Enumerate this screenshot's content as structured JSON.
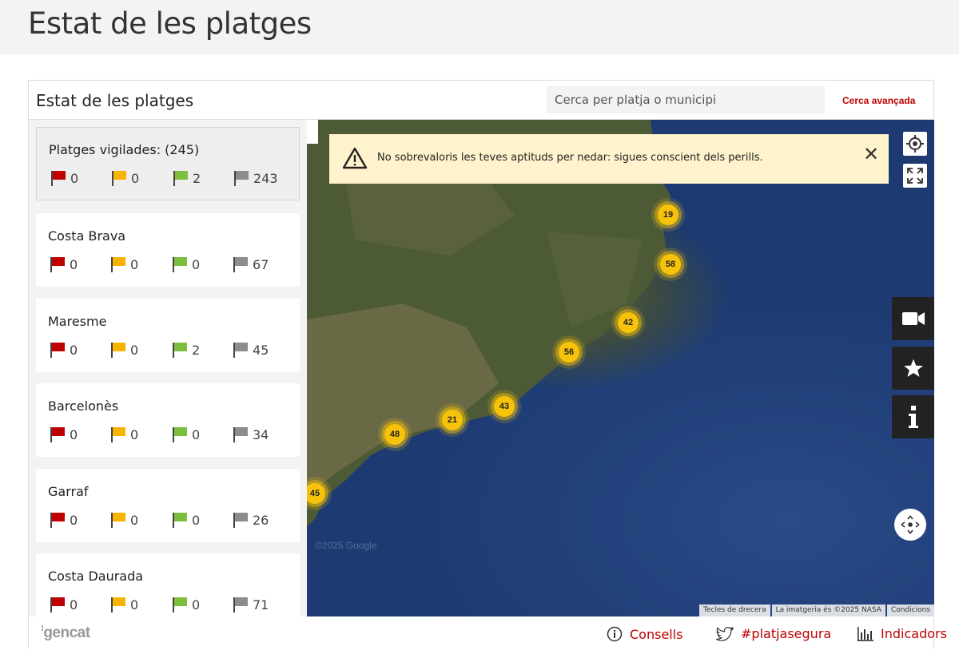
{
  "page": {
    "title": "Estat de les platges"
  },
  "widget": {
    "title": "Estat de les platges",
    "search_placeholder": "Cerca per platja o municipi",
    "advanced_search": "Cerca avançada"
  },
  "colors": {
    "red": "#c00000",
    "yellow": "#f6b400",
    "green": "#7cbf3f",
    "grey": "#8c8c8c",
    "cluster": "#f6c30a"
  },
  "summary": {
    "title": "Platges vigilades: (245)",
    "counts": [
      "0",
      "0",
      "2",
      "243"
    ]
  },
  "regions": [
    {
      "name": "Costa Brava",
      "counts": [
        "0",
        "0",
        "0",
        "67"
      ]
    },
    {
      "name": "Maresme",
      "counts": [
        "0",
        "0",
        "2",
        "45"
      ]
    },
    {
      "name": "Barcelonès",
      "counts": [
        "0",
        "0",
        "0",
        "34"
      ]
    },
    {
      "name": "Garraf",
      "counts": [
        "0",
        "0",
        "0",
        "26"
      ]
    },
    {
      "name": "Costa Daurada",
      "counts": [
        "0",
        "0",
        "0",
        "71"
      ]
    }
  ],
  "map": {
    "alert": "No sobrevaloris les teves aptituds per nedar: sigues conscient dels perills.",
    "clusters": [
      "19",
      "58",
      "42",
      "56",
      "43",
      "21",
      "48",
      "45"
    ],
    "attribution": [
      "Tecles de drecera",
      "La imatgeria és ©2025 NASA",
      "Condicions"
    ],
    "watermark": "©2025 Google",
    "side_buttons": [
      "camera-icon",
      "star-icon",
      "info-icon"
    ]
  },
  "footer": {
    "logo": "gencat",
    "links": [
      "Consells",
      "#platjasegura",
      "Indicadors"
    ]
  }
}
